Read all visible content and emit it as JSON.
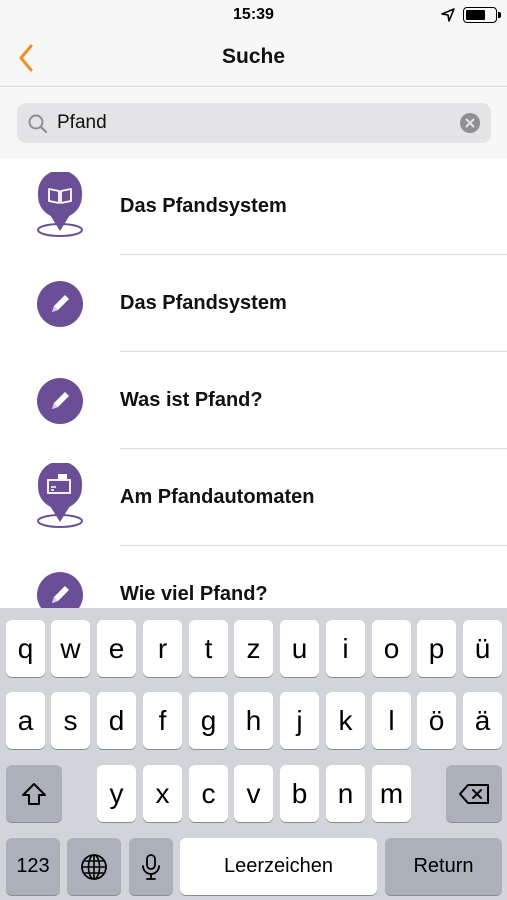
{
  "status_bar": {
    "time": "15:39"
  },
  "nav": {
    "title": "Suche"
  },
  "search": {
    "value": "Pfand"
  },
  "results": [
    {
      "label": "Das Pfandsystem",
      "icon": "book-pin-icon"
    },
    {
      "label": "Das Pfandsystem",
      "icon": "pencil-icon"
    },
    {
      "label": "Was ist Pfand?",
      "icon": "pencil-icon"
    },
    {
      "label": "Am Pfandautomaten",
      "icon": "machine-pin-icon"
    },
    {
      "label": "Wie viel Pfand?",
      "icon": "pencil-icon"
    }
  ],
  "keyboard": {
    "row1": [
      "q",
      "w",
      "e",
      "r",
      "t",
      "z",
      "u",
      "i",
      "o",
      "p",
      "ü"
    ],
    "row2": [
      "a",
      "s",
      "d",
      "f",
      "g",
      "h",
      "j",
      "k",
      "l",
      "ö",
      "ä"
    ],
    "row3": [
      "y",
      "x",
      "c",
      "v",
      "b",
      "n",
      "m"
    ],
    "numbers_label": "123",
    "space_label": "Leerzeichen",
    "return_label": "Return"
  },
  "colors": {
    "accent": "#f0902a",
    "icon_purple": "#6a4f96"
  }
}
